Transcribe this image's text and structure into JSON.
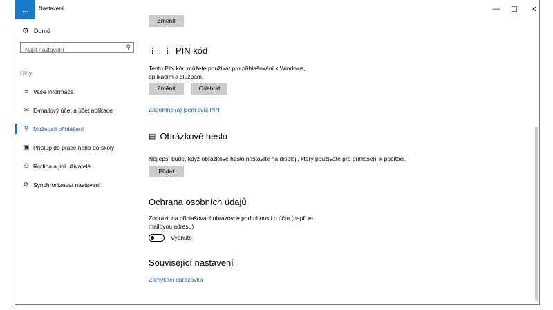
{
  "window": {
    "title": "Nastavení",
    "back_icon": "arrow-left-icon"
  },
  "sidebar": {
    "home_label": "Domů",
    "search_placeholder": "Najít nastavení",
    "section_label": "Účty",
    "items": [
      {
        "label": "Vaše informace",
        "icon": "contact-card-icon"
      },
      {
        "label": "E-mailový účet a účet aplikace",
        "icon": "mail-icon"
      },
      {
        "label": "Možnosti přihlášení",
        "icon": "key-icon",
        "active": true
      },
      {
        "label": "Přístup do práce nebo do školy",
        "icon": "briefcase-icon"
      },
      {
        "label": "Rodina a jiní uživatelé",
        "icon": "person-add-icon"
      },
      {
        "label": "Synchronizovat nastavení",
        "icon": "sync-icon"
      }
    ]
  },
  "main": {
    "top_button": "Změnit",
    "pin": {
      "title": "PIN kód",
      "description_line1": "Tento PIN kód můžete používat pro přihlašování k Windows,",
      "description_line2": "aplikacím a službám.",
      "change_button": "Změnit",
      "remove_button": "Odebrat",
      "forgot_link": "Zapomněl(a) jsem svůj PIN"
    },
    "picture_password": {
      "title": "Obrázkové heslo",
      "description": "Nejlepší bude, když obrázkové heslo nastavíte na displeji, který používáte pro přihlášení k počítači.",
      "add_button": "Přidat"
    },
    "privacy": {
      "title": "Ochrana osobních údajů",
      "description_line1": "Zobrazit na přihlašovací obrazovce podrobnosti o účtu (např. e-",
      "description_line2": "mailovou adresu)",
      "toggle_state": "Vypnuto"
    },
    "related": {
      "title": "Související nastavení",
      "link": "Zamykací obrazovka"
    }
  }
}
